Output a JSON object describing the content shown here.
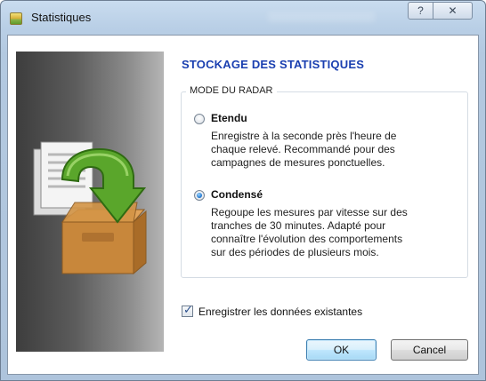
{
  "window": {
    "title": "Statistiques",
    "help_glyph": "?",
    "close_glyph": "✕"
  },
  "heading": "STOCKAGE DES STATISTIQUES",
  "radar_mode": {
    "legend": "MODE DU RADAR",
    "selected": "condense",
    "options": [
      {
        "id": "etendu",
        "label": "Etendu",
        "description": "Enregistre à la seconde près l'heure de\nchaque relevé. Recommandé pour des\n campagnes de mesures ponctuelles.",
        "checked": false
      },
      {
        "id": "condense",
        "label": "Condensé",
        "description": "Regoupe les mesures par vitesse sur des\ntranches de 30 minutes. Adapté pour\nconnaître l'évolution des comportements\nsur des périodes de plusieurs mois.",
        "checked": true
      }
    ]
  },
  "save_existing": {
    "label": "Enregistrer les données existantes",
    "checked": true
  },
  "buttons": {
    "ok": "OK",
    "cancel": "Cancel"
  },
  "colors": {
    "heading": "#1a3fb0",
    "ok_border": "#3c7fb1",
    "panel_dark": "#3d3d3d",
    "panel_light": "#b5b5b5",
    "arrow_green": "#5aa62b",
    "box_brown": "#c8873b"
  },
  "icons": {
    "app": "statistics-app-icon",
    "side": "archive-box-with-green-arrow-icon"
  }
}
